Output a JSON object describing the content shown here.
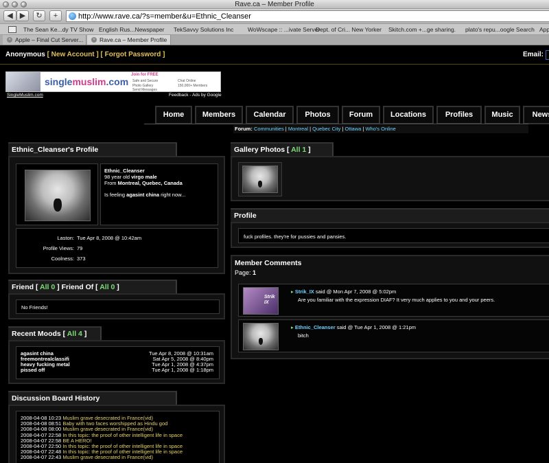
{
  "browser": {
    "title": "Rave.ca – Member Profile",
    "url": "http://www.rave.ca/?s=member&u=Ethnic_Cleanser",
    "bookmarks": [
      "The Sean Ke...dy TV Show",
      "English Rus...Newspaper",
      "TekSavvy Solutions Inc",
      "WoWscape :: ...ivate Server",
      "Dept. of Cri... New Yorker",
      "Skitch.com +...ge sharing.",
      "plato's repu...oogle Search",
      "App"
    ],
    "tabs": [
      "Apple – Final Cut Server...",
      "Rave.ca – Member Profile"
    ]
  },
  "userbar": {
    "user": "Anonymous",
    "new_account": "New Account",
    "forgot": "Forgot Password",
    "email_label": "Email:"
  },
  "ad": {
    "logo_a": "single",
    "logo_b": "muslim",
    "logo_c": ".com",
    "join": "Join for FREE",
    "f1": "Safe and Secure",
    "f2": "Chat Online",
    "f3": "Photo Gallery",
    "f4": "150,000+ Members",
    "f5": "Send Messages",
    "caption": "SingleMuslim.com",
    "feedback": "Feedback - Ads by Google"
  },
  "nav": [
    "Home",
    "Members",
    "Calendar",
    "Photos",
    "Forum",
    "Locations",
    "Profiles",
    "Music",
    "News"
  ],
  "forum": {
    "label": "Forum:",
    "links": [
      "Communities",
      "Montreal",
      "Quebec City",
      "Ottawa",
      "Who's Online"
    ]
  },
  "profile_card": {
    "title": "Ethnic_Cleanser's Profile",
    "username": "Ethnic_Cleanser",
    "age_line_pre": "98 year old ",
    "age_line_bold": "virgo male",
    "from_pre": "From ",
    "from_bold": "Montreal, Quebec, Canada",
    "feeling_pre": "Is feeling ",
    "feeling_bold": "agasint china",
    "feeling_post": " right now...",
    "laston_label": "Laston:",
    "laston": "Tue Apr 8, 2008 @ 10:42am",
    "views_label": "Profile Views:",
    "views": "79",
    "cool_label": "Coolness:",
    "cool": "373"
  },
  "friends": {
    "friend": "Friend",
    "friend_count": "All 0",
    "friend_of": "Friend Of",
    "friend_of_count": "All 0",
    "none": "No Friends!"
  },
  "moods": {
    "title": "Recent Moods",
    "count": "All 4",
    "rows": [
      {
        "mood": "agasint china",
        "date": "Tue Apr 8, 2008 @ 10:31am"
      },
      {
        "mood": "freemontrealclassifi",
        "date": "Sat Apr 5, 2008 @ 8:40pm"
      },
      {
        "mood": "heavy fucking metal",
        "date": "Tue Apr 1, 2008 @ 4:37pm"
      },
      {
        "mood": "pissed off",
        "date": "Tue Apr 1, 2008 @ 1:18pm"
      }
    ]
  },
  "discussion": {
    "title": "Discussion Board History",
    "rows": [
      {
        "date": "2008-04-08 10:23",
        "topic": "Muslim grave desecrated in France(vid)"
      },
      {
        "date": "2008-04-08 08:51",
        "topic": "Baby with two faces worshipped as Hindu god"
      },
      {
        "date": "2008-04-08 08:00",
        "topic": "Muslim grave desecrated in France(vid)"
      },
      {
        "date": "2008-04-07 22:58",
        "topic": "In this topic: the proof of other intelligent life in space"
      },
      {
        "date": "2008-04-07 22:58",
        "topic": "BE A HERO!"
      },
      {
        "date": "2008-04-07 22:50",
        "topic": "In this topic: the proof of other intelligent life in space"
      },
      {
        "date": "2008-04-07 22:48",
        "topic": "In this topic: the proof of other intelligent life in space"
      },
      {
        "date": "2008-04-07 22:43",
        "topic": "Muslim grave desecrated in France(vid)"
      }
    ]
  },
  "gallery": {
    "title": "Gallery Photos",
    "count": "All 1"
  },
  "profile_text": {
    "title": "Profile",
    "text": "fuck profiles. they're for pussies and pansies."
  },
  "comments": {
    "title": "Member Comments",
    "page_label": "Page:",
    "page": "1",
    "items": [
      {
        "author": "Strik_IX",
        "said": " said @ Mon Apr 7, 2008 @ 5:02pm",
        "text": "Are you familiar with the expression DIAF? It very much applies to you and your peers.",
        "avatar_text": "Strik IX"
      },
      {
        "author": "Ethnic_Cleanser",
        "said": " said @ Tue Apr 1, 2008 @ 1:21pm",
        "text": "bitch"
      }
    ]
  },
  "colors": {
    "accent_yellow": "#e0c15a",
    "link_green": "#7dde76",
    "link_cyan": "#6fd3ff"
  }
}
